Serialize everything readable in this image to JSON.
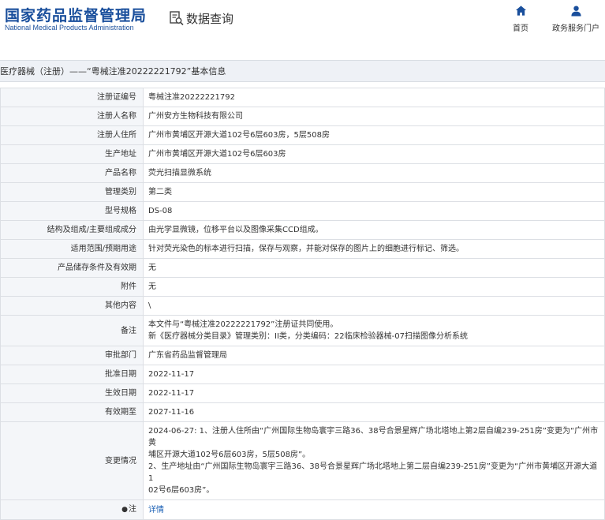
{
  "header": {
    "logo_cn": "国家药品监督管理局",
    "logo_en": "National Medical Products Administration",
    "query_label": "数据查询",
    "nav_home": "首页",
    "nav_portal": "政务服务门户"
  },
  "title": "医疗器械（注册）——“粤械注准20222221792”基本信息",
  "rows": [
    {
      "label": "注册证编号",
      "value": "粤械注准20222221792"
    },
    {
      "label": "注册人名称",
      "value": "广州安方生物科技有限公司"
    },
    {
      "label": "注册人住所",
      "value": "广州市黄埔区开源大道102号6层603房，5层508房"
    },
    {
      "label": "生产地址",
      "value": "广州市黄埔区开源大道102号6层603房"
    },
    {
      "label": "产品名称",
      "value": "荧光扫描显微系统"
    },
    {
      "label": "管理类别",
      "value": "第二类"
    },
    {
      "label": "型号规格",
      "value": "DS-08"
    },
    {
      "label": "结构及组成/主要组成成分",
      "value": "由光学显微镜，位移平台以及图像采集CCD组成。"
    },
    {
      "label": "适用范围/预期用途",
      "value": "针对荧光染色的标本进行扫描，保存与观察，并能对保存的图片上的细胞进行标记、筛选。"
    },
    {
      "label": "产品储存条件及有效期",
      "value": "无"
    },
    {
      "label": "附件",
      "value": "无"
    },
    {
      "label": "其他内容",
      "value": "\\"
    },
    {
      "label": "备注",
      "lines": [
        "本文件与“粤械注准20222221792”注册证共同使用。",
        "新《医疗器械分类目录》管理类别：II类，分类编码：22临床检验器械-07扫描图像分析系统"
      ]
    },
    {
      "label": "审批部门",
      "value": "广东省药品监督管理局"
    },
    {
      "label": "批准日期",
      "value": "2022-11-17"
    },
    {
      "label": "生效日期",
      "value": "2022-11-17"
    },
    {
      "label": "有效期至",
      "value": "2027-11-16"
    },
    {
      "label": "变更情况",
      "lines": [
        "2024-06-27: 1、注册人住所由“广州国际生物岛寰宇三路36、38号合景星辉广场北塔地上第2层自编239-251房”变更为“广州市黄",
        "埔区开源大道102号6层603房，5层508房”。",
        "2、生产地址由“广州国际生物岛寰宇三路36、38号合景星辉广场北塔地上第二层自编239-251房”变更为“广州市黄埔区开源大道1",
        "02号6层603房”。"
      ]
    }
  ],
  "note": {
    "label": "注",
    "link": "详情"
  },
  "colors": {
    "brand": "#1a4f9c",
    "label_bg": "#f4f6f9",
    "border": "#dcdfe4",
    "link": "#1a5fb4"
  }
}
